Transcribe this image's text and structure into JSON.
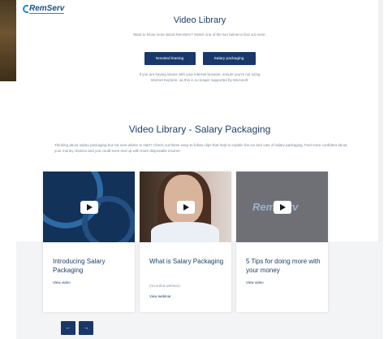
{
  "brand": {
    "logo_text": "RemServ"
  },
  "library": {
    "title": "Video Library",
    "intro": "Want to know more about RemServ? Select one of the two below to find out more.",
    "buttons": [
      "Novated leasing",
      "Salary packaging"
    ],
    "notice": "If you are having issues with your internet browser, ensure you're not using Internet Explorer, as this is no longer supported by Microsoft."
  },
  "salary_packaging": {
    "title": "Video Library - Salary Packaging",
    "description": "Thinking about salary packaging but not sure where to start? Check out these easy-to-follow clips that help to explain the ins and outs of salary packaging. Feel more confident about your money choices and you could even end up with more disposable income."
  },
  "cards": [
    {
      "title": "Introducing Salary Packaging",
      "meta": "",
      "link": "View video",
      "thumb_icon": "play-icon"
    },
    {
      "title": "What is Salary Packaging",
      "meta": "(recorded webinar)",
      "link": "View webinar",
      "thumb_icon": "play-icon"
    },
    {
      "title": "5 Tips for doing more with your money",
      "meta": "",
      "link": "View video",
      "thumb_icon": "play-icon"
    }
  ],
  "card3_thumb_logo": "RemServ",
  "nav": {
    "prev": "←",
    "next": "→"
  },
  "colors": {
    "navy": "#19386a",
    "accent": "#1e8ec9",
    "heading": "#203f66"
  }
}
